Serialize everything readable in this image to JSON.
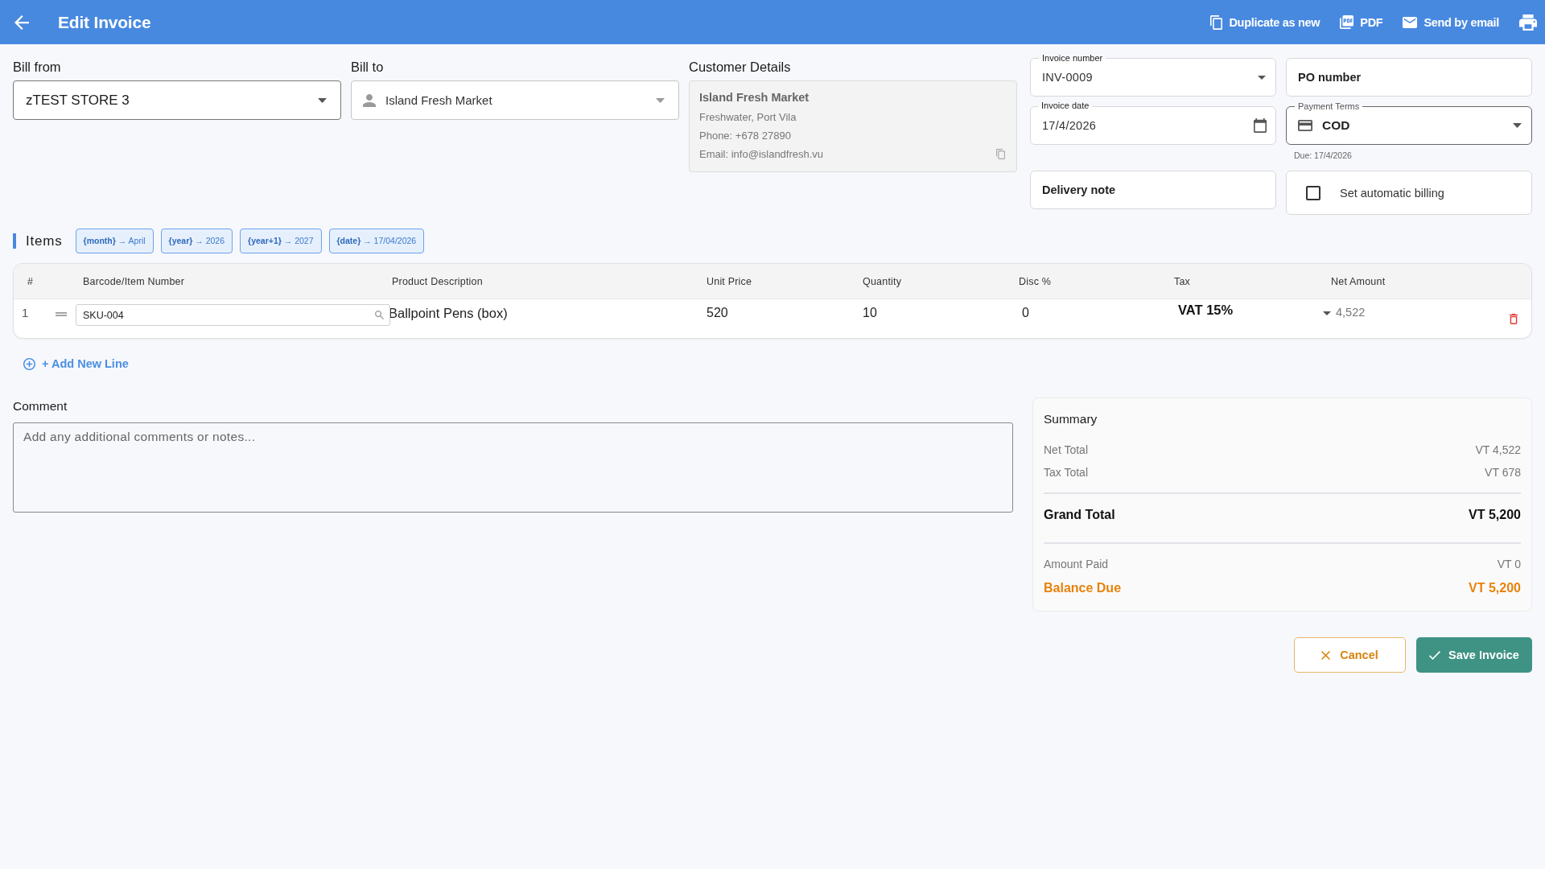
{
  "app_bar": {
    "title": "Edit Invoice",
    "actions": [
      {
        "kind": "duplicate",
        "label": "Duplicate as new"
      },
      {
        "kind": "pdf",
        "label": "PDF"
      },
      {
        "kind": "email",
        "label": "Send by email"
      },
      {
        "kind": "print"
      }
    ]
  },
  "bill_from": {
    "label": "Bill from",
    "value": "zTEST STORE 3"
  },
  "bill_to": {
    "label": "Bill to",
    "value": "Island Fresh Market"
  },
  "customer_details": {
    "title": "Customer Details",
    "name": "Island Fresh Market",
    "lines": [
      "Freshwater, Port Vila",
      "Phone: +678 27890",
      "Email: info@islandfresh.vu"
    ]
  },
  "invoice_number": {
    "label": "Invoice number",
    "value": "INV-0009"
  },
  "po_number": {
    "placeholder": "PO number"
  },
  "invoice_date": {
    "label": "Invoice date",
    "value": "17/4/2026"
  },
  "payment_terms": {
    "label": "Payment Terms",
    "value": "COD",
    "due": "Due: 17/4/2026"
  },
  "delivery_note": {
    "placeholder": "Delivery note"
  },
  "automatic_billing": {
    "label": "Set automatic billing",
    "checked": false
  },
  "items": {
    "title": "Items",
    "tokens": [
      "**{month}** → April",
      "**{year}** → 2026",
      "**{year+1}** → 2027",
      "**{date}** → 17/04/2026"
    ],
    "table": {
      "columns": [
        "#",
        "Barcode/Item Number",
        "Product Description",
        "Unit Price",
        "Quantity",
        "Disc %",
        "Tax",
        "Net Amount"
      ],
      "rows": [
        {
          "number": "1",
          "barcode": "SKU-004",
          "description": "Ballpoint Pens (box)",
          "unit_price": "520",
          "quantity": "10",
          "discount": "0",
          "tax": "VAT 15%",
          "net_amount": "4,522"
        }
      ]
    },
    "add_line": "+ Add New Line"
  },
  "comment": {
    "label": "Comment",
    "placeholder": "Add any additional comments or notes..."
  },
  "summary": {
    "title": "Summary",
    "lines": [
      {
        "kind": "minor",
        "label": "Net Total",
        "value": "VT 4,522"
      },
      {
        "kind": "minor",
        "label": "Tax Total",
        "value": "VT 678"
      },
      {
        "kind": "total",
        "label": "Grand Total",
        "value": "VT 5,200"
      },
      {
        "kind": "minor",
        "label": "Amount Paid",
        "value": "VT 0"
      },
      {
        "kind": "due",
        "label": "Balance Due",
        "value": "VT 5,200"
      }
    ]
  },
  "buttons": [
    {
      "kind": "cancel",
      "label": "Cancel"
    },
    {
      "kind": "save",
      "label": "Save Invoice"
    }
  ]
}
